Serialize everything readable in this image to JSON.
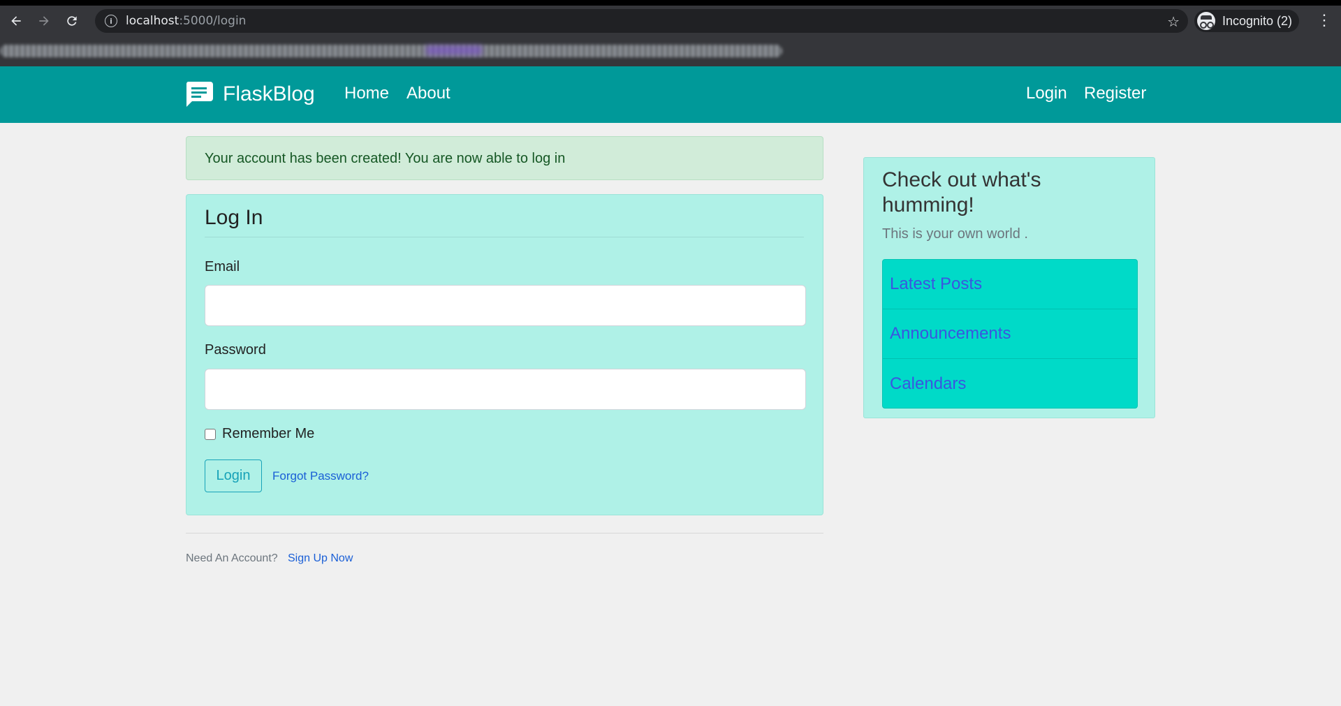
{
  "browser": {
    "url_host": "localhost",
    "url_path": ":5000/login",
    "profile_label": "Incognito (2)"
  },
  "navbar": {
    "brand": "FlaskBlog",
    "links": [
      "Home",
      "About"
    ],
    "right_links": [
      "Login",
      "Register"
    ],
    "background_color": "#009999"
  },
  "alert": {
    "message": "Your account has been created! You are now able to log in"
  },
  "login_form": {
    "title": "Log In",
    "email_label": "Email",
    "email_value": "",
    "password_label": "Password",
    "password_value": "",
    "remember_label": "Remember Me",
    "remember_checked": false,
    "submit_label": "Login",
    "forgot_label": "Forgot Password?"
  },
  "footer": {
    "prompt": "Need An Account?",
    "signup_label": "Sign Up Now"
  },
  "sidebar": {
    "title": "Check out what's humming!",
    "subtitle": "This is your own world .",
    "items": [
      "Latest Posts",
      "Announcements",
      "Calendars"
    ]
  }
}
